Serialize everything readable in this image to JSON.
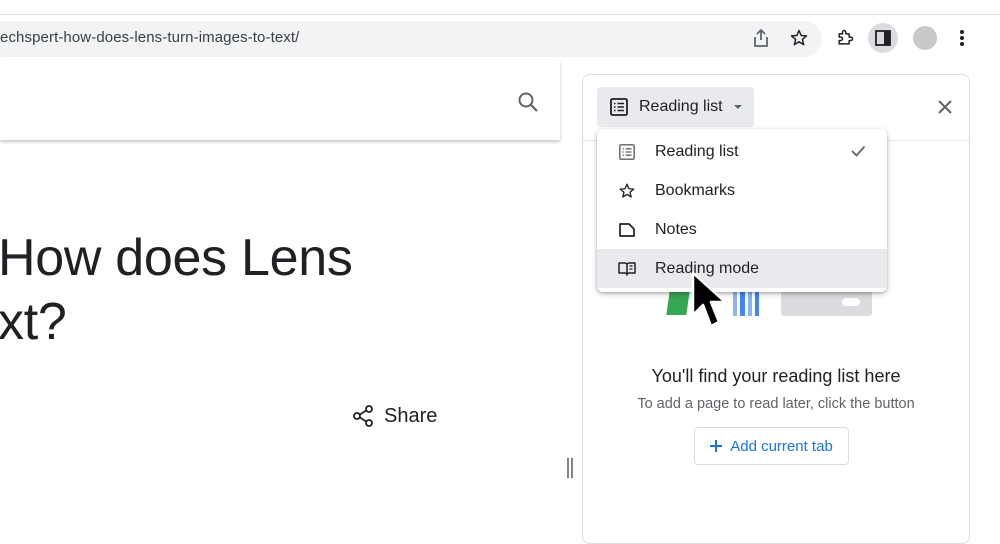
{
  "browser": {
    "url": "echspert-how-does-lens-turn-images-to-text/",
    "toolbar_icons": [
      "share-icon",
      "bookmark-star-icon",
      "extensions-icon",
      "side-panel-icon",
      "profile-avatar",
      "more-menu-icon"
    ]
  },
  "page": {
    "title": "How does Lens\nxt?",
    "share_label": "Share"
  },
  "side_panel": {
    "dropdown_label": "Reading list",
    "menu_items": [
      {
        "label": "Reading list",
        "icon": "reading-list-icon",
        "checked": true
      },
      {
        "label": "Bookmarks",
        "icon": "star-icon",
        "checked": false
      },
      {
        "label": "Notes",
        "icon": "notes-icon",
        "checked": false
      },
      {
        "label": "Reading mode",
        "icon": "reading-mode-icon",
        "checked": false
      }
    ],
    "empty_title": "You'll find your reading list here",
    "empty_subtitle": "To add a page to read later, click the button",
    "add_button_label": "Add current tab"
  },
  "colors": {
    "accent": "#1a73e8",
    "hover_bg": "#e8eaed",
    "text_primary": "#202124",
    "text_secondary": "#5f6368"
  }
}
